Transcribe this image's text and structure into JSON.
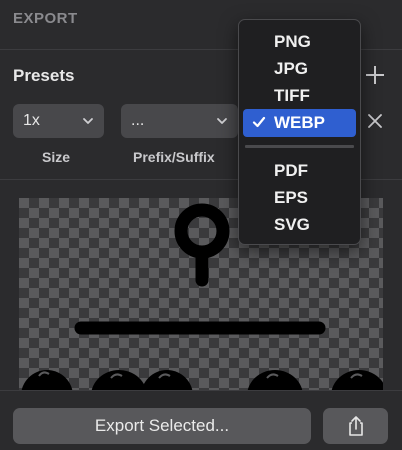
{
  "section": {
    "title": "EXPORT"
  },
  "presets": {
    "title": "Presets",
    "size_value": "1x",
    "size_label": "Size",
    "prefix_value": "...",
    "prefix_label": "Prefix/Suffix"
  },
  "format_menu": {
    "items": [
      "PNG",
      "JPG",
      "TIFF",
      "WEBP",
      "PDF",
      "EPS",
      "SVG"
    ],
    "selected": "WEBP"
  },
  "footer": {
    "export_label": "Export Selected..."
  },
  "icons": {
    "add": "plus-icon",
    "remove": "close-icon",
    "share": "share-icon",
    "dropdown": "chevron-down-icon",
    "selected": "checkmark-icon"
  },
  "colors": {
    "background": "#2b2b2d",
    "control": "#48484b",
    "menu_background": "#1f1f21",
    "selection": "#2f5fd0"
  }
}
